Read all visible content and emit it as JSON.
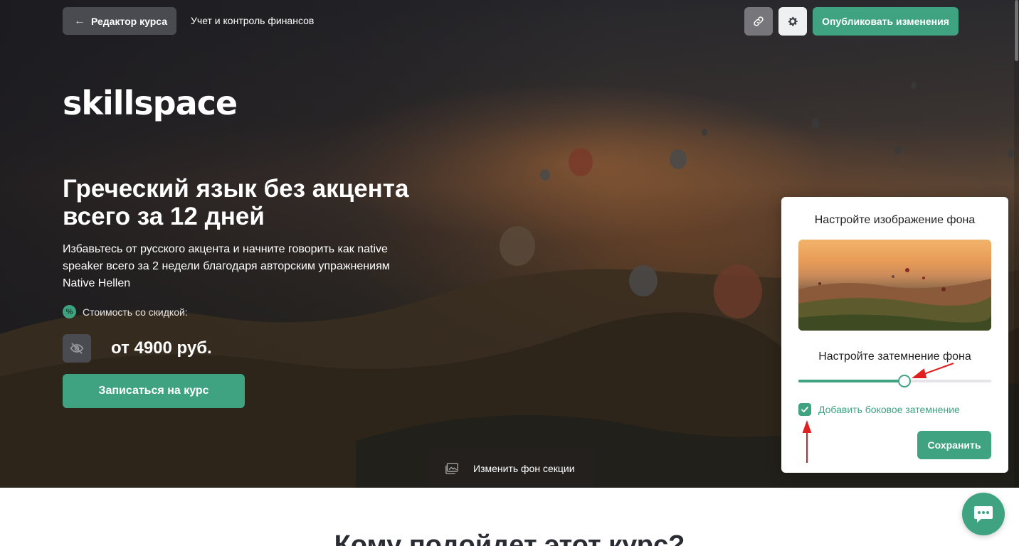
{
  "topbar": {
    "back_label": "Редактор курса",
    "course_name": "Учет и контроль финансов",
    "publish_label": "Опубликовать изменения"
  },
  "hero": {
    "logo": "skillspace",
    "title": "Греческий язык без акцента всего за 12 дней",
    "subtitle": "Избавьтесь от русского акцента и начните говорить как native speaker всего за 2 недели благодаря авторским упражнениям Native Hellen",
    "discount_label": "Стоимость со скидкой:",
    "price": "от 4900 руб.",
    "enroll_label": "Записаться на курс",
    "change_bg_label": "Изменить фон секции"
  },
  "panel": {
    "title": "Настройте изображение фона",
    "dim_title": "Настройте затемнение фона",
    "dim_level": 0.55,
    "side_dim_checked": true,
    "side_dim_label": "Добавить боковое затемнение",
    "save_label": "Сохранить"
  },
  "next_section": {
    "title": "Кому подойдет этот курс?"
  },
  "colors": {
    "accent": "#3fa382",
    "dark_button": "#4a4b50"
  }
}
